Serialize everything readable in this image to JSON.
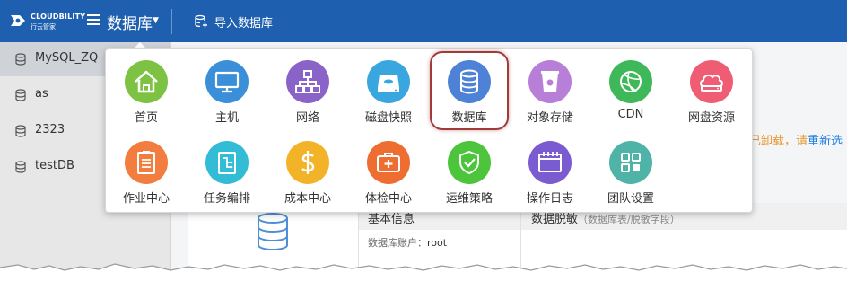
{
  "header": {
    "logo_text": "CLOUDBILITY",
    "logo_subtext": "行云管家",
    "module_title": "数据库",
    "import_label": "导入数据库",
    "colors": {
      "bar": "#1f5fb0",
      "text": "#ffffff"
    }
  },
  "sidebar": {
    "items": [
      {
        "label": "MySQL_ZQ",
        "active": true
      },
      {
        "label": "as",
        "active": false
      },
      {
        "label": "2323",
        "active": false
      },
      {
        "label": "testDB",
        "active": false
      }
    ]
  },
  "popup": {
    "selected": "数据库",
    "tiles": [
      {
        "label": "首页",
        "icon": "home-icon",
        "color": "#7dc242"
      },
      {
        "label": "主机",
        "icon": "monitor-icon",
        "color": "#3b8fd9"
      },
      {
        "label": "网络",
        "icon": "network-icon",
        "color": "#8a63c9"
      },
      {
        "label": "磁盘快照",
        "icon": "disk-icon",
        "color": "#3aa6e0"
      },
      {
        "label": "数据库",
        "icon": "database-icon",
        "color": "#4d82d6"
      },
      {
        "label": "对象存储",
        "icon": "bucket-icon",
        "color": "#b77fd8"
      },
      {
        "label": "CDN",
        "icon": "globe-icon",
        "color": "#3fb85a"
      },
      {
        "label": "网盘资源",
        "icon": "cloud-disk-icon",
        "color": "#ee5d74"
      },
      {
        "label": "作业中心",
        "icon": "clipboard-icon",
        "color": "#f27d3f"
      },
      {
        "label": "任务编排",
        "icon": "task-flow-icon",
        "color": "#33bcd6"
      },
      {
        "label": "成本中心",
        "icon": "dollar-icon",
        "color": "#f3b329"
      },
      {
        "label": "体检中心",
        "icon": "medical-kit-icon",
        "color": "#ee6d30"
      },
      {
        "label": "运维策略",
        "icon": "shield-icon",
        "color": "#4cc43c"
      },
      {
        "label": "操作日志",
        "icon": "calendar-log-icon",
        "color": "#7a5bd0"
      },
      {
        "label": "团队设置",
        "icon": "team-grid-icon",
        "color": "#4fb3a7"
      }
    ]
  },
  "main": {
    "warning_text": "已卸载，请",
    "warning_link": "重新选",
    "info_basic_title": "基本信息",
    "info_mask_title": "数据脱敏",
    "info_mask_sub": "（数据库表/脱敏字段）",
    "account_label": "数据库账户：",
    "account_value": "root"
  }
}
